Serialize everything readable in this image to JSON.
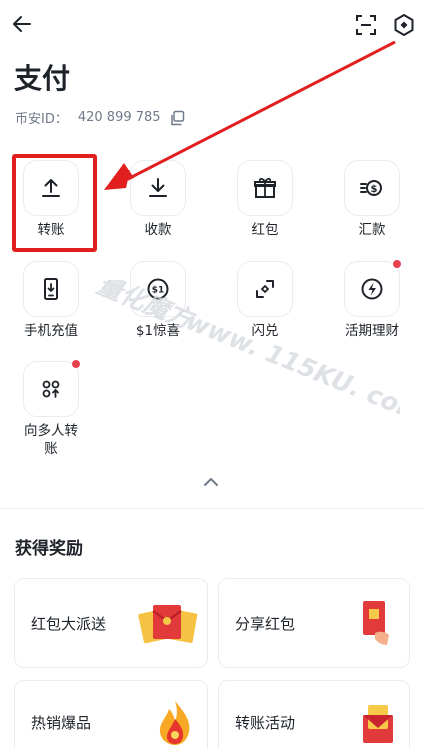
{
  "header": {
    "back_icon": "arrow-left-icon",
    "scan_icon": "scan-icon",
    "settings_icon": "settings-icon"
  },
  "page": {
    "title": "支付",
    "id_label": "币安ID：",
    "id_value": "420 899 785",
    "copy_icon": "copy-icon"
  },
  "actions": [
    {
      "label": "转账",
      "icon": "upload-icon"
    },
    {
      "label": "收款",
      "icon": "download-icon"
    },
    {
      "label": "红包",
      "icon": "gift-icon"
    },
    {
      "label": "汇款",
      "icon": "money-transfer-icon"
    },
    {
      "label": "手机充值",
      "icon": "phone-topup-icon"
    },
    {
      "label": "$1惊喜",
      "icon": "dollar-coin-icon"
    },
    {
      "label": "闪兑",
      "icon": "convert-icon"
    },
    {
      "label": "活期理财",
      "icon": "lightning-icon",
      "badge": true
    },
    {
      "label": "向多人转账",
      "label_lines": [
        "向多人转",
        "账"
      ],
      "icon": "multi-transfer-icon",
      "badge": true
    }
  ],
  "watermark": {
    "line1": "量化魔方",
    "line2": "www. 115KU. com"
  },
  "rewards": {
    "title": "获得奖励",
    "cards": [
      {
        "label": "红包大派送",
        "icon": "red-envelopes-icon"
      },
      {
        "label": "分享红包",
        "icon": "share-red-envelope-icon"
      },
      {
        "label": "热销爆品",
        "icon": "hot-fire-icon"
      },
      {
        "label": "转账活动",
        "icon": "transfer-envelope-icon"
      }
    ]
  },
  "colors": {
    "highlight": "#e21f1f",
    "badge": "#e8424f",
    "text": "#1e2329",
    "muted": "#707a8a",
    "border": "#eaecef"
  }
}
